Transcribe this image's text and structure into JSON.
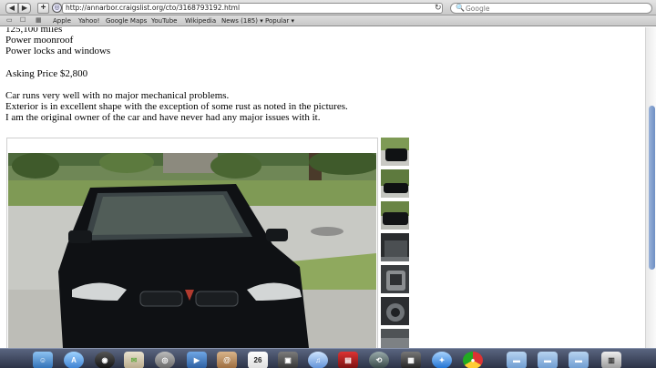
{
  "browser": {
    "back_glyph": "◀",
    "forward_glyph": "▶",
    "new_tab_glyph": "+",
    "globe_glyph": "◎",
    "url": "http://annarbor.craigslist.org/cto/3168793192.html",
    "reload_glyph": "↻",
    "search_placeholder": "Google",
    "search_icon": "search-icon"
  },
  "bookmarks": {
    "items": [
      "Apple",
      "Yahoo!",
      "Google Maps",
      "YouTube",
      "Wikipedia",
      "News (185) ▾",
      "Popular ▾"
    ]
  },
  "listing": {
    "lines": [
      "125,100 miles",
      "Power moonroof",
      "Power locks and windows",
      "Asking Price $2,800",
      "Car runs very well with no major mechanical problems.",
      "Exterior is in excellent shape with the exception of some rust as noted in the pictures.",
      "I am the original owner of the car and have never had any major issues with it."
    ]
  },
  "gallery": {
    "thumbnail_count": 7,
    "car_color": "#0f1114"
  },
  "dock": {
    "items": [
      "finder",
      "app-store",
      "dashboard",
      "mail-stamp",
      "facetime",
      "address-book",
      "calendar",
      "photo-booth",
      "itunes",
      "photo",
      "preview",
      "time-machine",
      "iphoto",
      "safari",
      "chrome",
      "applications-folder",
      "documents-folder",
      "downloads-folder",
      "trash"
    ],
    "calendar_day": "26"
  },
  "colors": {
    "accent": "#6f8fc4",
    "dock": "#2c3347"
  }
}
